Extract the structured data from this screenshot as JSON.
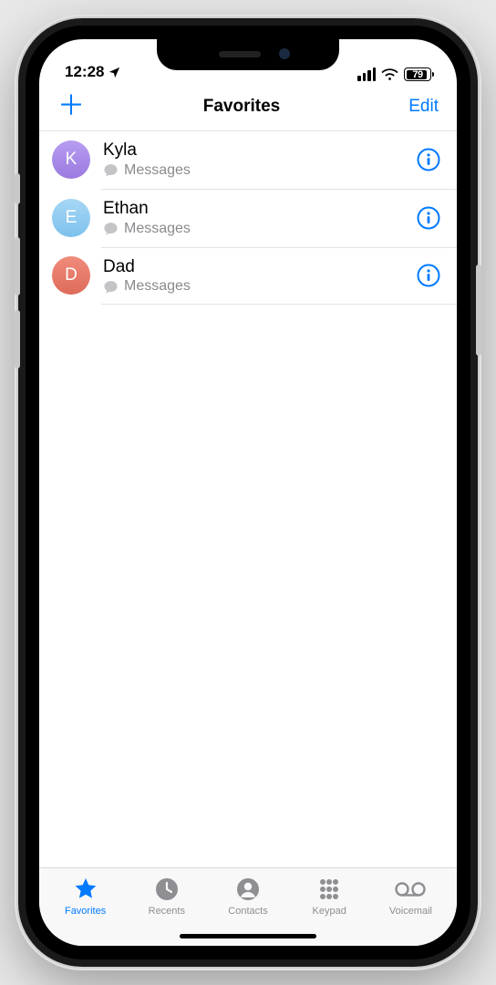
{
  "status": {
    "time": "12:28",
    "battery": "79"
  },
  "nav": {
    "title": "Favorites",
    "edit": "Edit"
  },
  "favorites": [
    {
      "initial": "K",
      "name": "Kyla",
      "subtitle": "Messages",
      "avatar_bg": "linear-gradient(180deg,#b79df0,#9a7ae0)"
    },
    {
      "initial": "E",
      "name": "Ethan",
      "subtitle": "Messages",
      "avatar_bg": "linear-gradient(180deg,#a7d7f5,#7cc1ed)"
    },
    {
      "initial": "D",
      "name": "Dad",
      "subtitle": "Messages",
      "avatar_bg": "linear-gradient(180deg,#f08b7b,#de6b5a)"
    }
  ],
  "tabs": {
    "favorites": "Favorites",
    "recents": "Recents",
    "contacts": "Contacts",
    "keypad": "Keypad",
    "voicemail": "Voicemail"
  }
}
